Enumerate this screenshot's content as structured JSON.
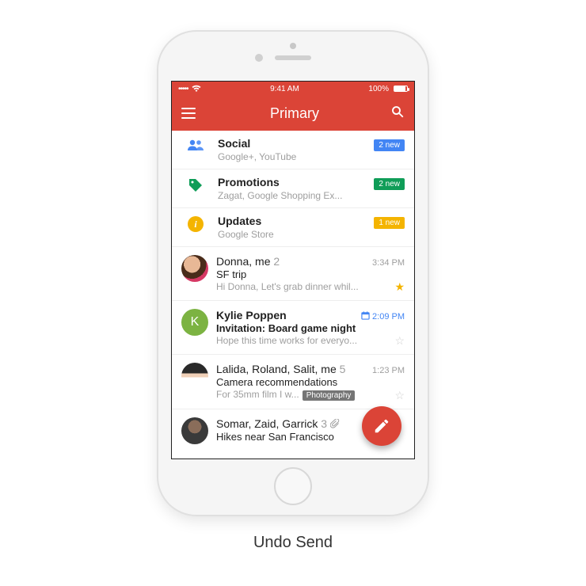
{
  "caption": "Undo Send",
  "statusbar": {
    "signal": "•••••",
    "wifi": "wifi",
    "time": "9:41 AM",
    "battery_pct": "100%"
  },
  "header": {
    "title": "Primary"
  },
  "categories": [
    {
      "name": "Social",
      "sub": "Google+, YouTube",
      "badge": "2 new",
      "badge_color": "blue",
      "icon": "people"
    },
    {
      "name": "Promotions",
      "sub": "Zagat, Google Shopping Ex...",
      "badge": "2 new",
      "badge_color": "green",
      "icon": "tag"
    },
    {
      "name": "Updates",
      "sub": "Google Store",
      "badge": "1 new",
      "badge_color": "yellow",
      "icon": "info"
    }
  ],
  "emails": [
    {
      "sender": "Donna, me",
      "count": "2",
      "subject": "SF trip",
      "snippet": "Hi Donna, Let's grab dinner whil...",
      "time": "3:34 PM",
      "starred": true,
      "unread": false,
      "avatar_type": "photo",
      "avatar_class": "av-donna"
    },
    {
      "sender": "Kylie Poppen",
      "count": "",
      "subject": "Invitation: Board game night",
      "snippet": "Hope this time works for everyo...",
      "time": "2:09 PM",
      "starred": false,
      "unread": true,
      "calendar": true,
      "avatar_type": "letter",
      "avatar_letter": "K",
      "avatar_bg": "#7cb342"
    },
    {
      "sender": "Lalida, Roland, Salit, me",
      "count": "5",
      "subject": "Camera recommendations",
      "snippet_prefix": "For 35mm film I w...",
      "label": "Photography",
      "time": "1:23 PM",
      "starred": false,
      "unread": false,
      "avatar_type": "photo",
      "avatar_class": "av-lalida"
    },
    {
      "sender": "Somar, Zaid, Garrick",
      "count": "3",
      "subject": "Hikes near San Francisco",
      "snippet": "",
      "time": "",
      "attachment": true,
      "unread": false,
      "avatar_type": "photo",
      "avatar_class": "av-somar"
    }
  ]
}
